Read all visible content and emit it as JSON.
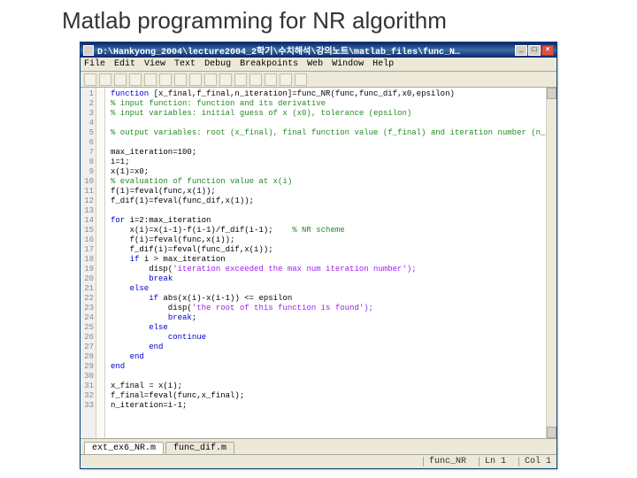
{
  "slide": {
    "title": "Matlab programming for NR algorithm"
  },
  "window": {
    "title": "D:\\Hankyong_2004\\lecture2004_2학기\\수치해석\\강의노트\\matlab_files\\func_N…",
    "menu": [
      "File",
      "Edit",
      "View",
      "Text",
      "Debug",
      "Breakpoints",
      "Web",
      "Window",
      "Help"
    ],
    "tabs": {
      "active": "ext_ex6_NR.m",
      "inactive": "func_dif.m"
    },
    "status": {
      "fn": "func_NR",
      "ln": "Ln 1",
      "col": "Col 1"
    }
  },
  "code": {
    "lines": [
      {
        "n": "1",
        "type": "kw",
        "t": "function [x_final,f_final,n_iteration]=func_NR(func,func_dif,x0,epsilon)"
      },
      {
        "n": "2",
        "type": "cm",
        "t": "% input function: function and its derivative"
      },
      {
        "n": "3",
        "type": "cm",
        "t": "% input variables: initial guess of x (x0), tolerance (epsilon)"
      },
      {
        "n": "4",
        "type": "",
        "t": ""
      },
      {
        "n": "5",
        "type": "cm",
        "t": "% output variables: root (x_final), final function value (f_final) and iteration number (n_iteration)"
      },
      {
        "n": "6",
        "type": "",
        "t": ""
      },
      {
        "n": "7",
        "type": "",
        "t": "max_iteration=100;"
      },
      {
        "n": "8",
        "type": "",
        "t": "i=1;"
      },
      {
        "n": "9",
        "type": "",
        "t": "x(1)=x0;"
      },
      {
        "n": "10",
        "type": "cm",
        "t": "% evaluation of function value at x(i)"
      },
      {
        "n": "11",
        "type": "",
        "t": "f(1)=feval(func,x(1));"
      },
      {
        "n": "12",
        "type": "",
        "t": "f_dif(1)=feval(func_dif,x(1));"
      },
      {
        "n": "13",
        "type": "",
        "t": ""
      },
      {
        "n": "14",
        "type": "for",
        "t": "for i=2:max_iteration"
      },
      {
        "n": "15",
        "type": "mix",
        "t": "    x(i)=x(i-1)-f(i-1)/f_dif(i-1);    % NR scheme"
      },
      {
        "n": "16",
        "type": "",
        "t": "    f(i)=feval(func,x(i));"
      },
      {
        "n": "17",
        "type": "",
        "t": "    f_dif(i)=feval(func_dif,x(i));"
      },
      {
        "n": "18",
        "type": "if",
        "t": "    if i > max_iteration"
      },
      {
        "n": "19",
        "type": "str",
        "t": "        disp('iteration exceeded the max num iteration number');"
      },
      {
        "n": "20",
        "type": "br",
        "t": "        break"
      },
      {
        "n": "21",
        "type": "el",
        "t": "    else"
      },
      {
        "n": "22",
        "type": "if",
        "t": "        if abs(x(i)-x(i-1)) <= epsilon"
      },
      {
        "n": "23",
        "type": "str",
        "t": "            disp('the root of this function is found');"
      },
      {
        "n": "24",
        "type": "br",
        "t": "            break;"
      },
      {
        "n": "25",
        "type": "el",
        "t": "        else"
      },
      {
        "n": "26",
        "type": "ct",
        "t": "            continue"
      },
      {
        "n": "27",
        "type": "end",
        "t": "        end"
      },
      {
        "n": "28",
        "type": "end",
        "t": "    end"
      },
      {
        "n": "29",
        "type": "end",
        "t": "end"
      },
      {
        "n": "30",
        "type": "",
        "t": ""
      },
      {
        "n": "31",
        "type": "",
        "t": "x_final = x(i);"
      },
      {
        "n": "32",
        "type": "",
        "t": "f_final=feval(func,x_final);"
      },
      {
        "n": "33",
        "type": "",
        "t": "n_iteration=i-1;"
      }
    ]
  }
}
